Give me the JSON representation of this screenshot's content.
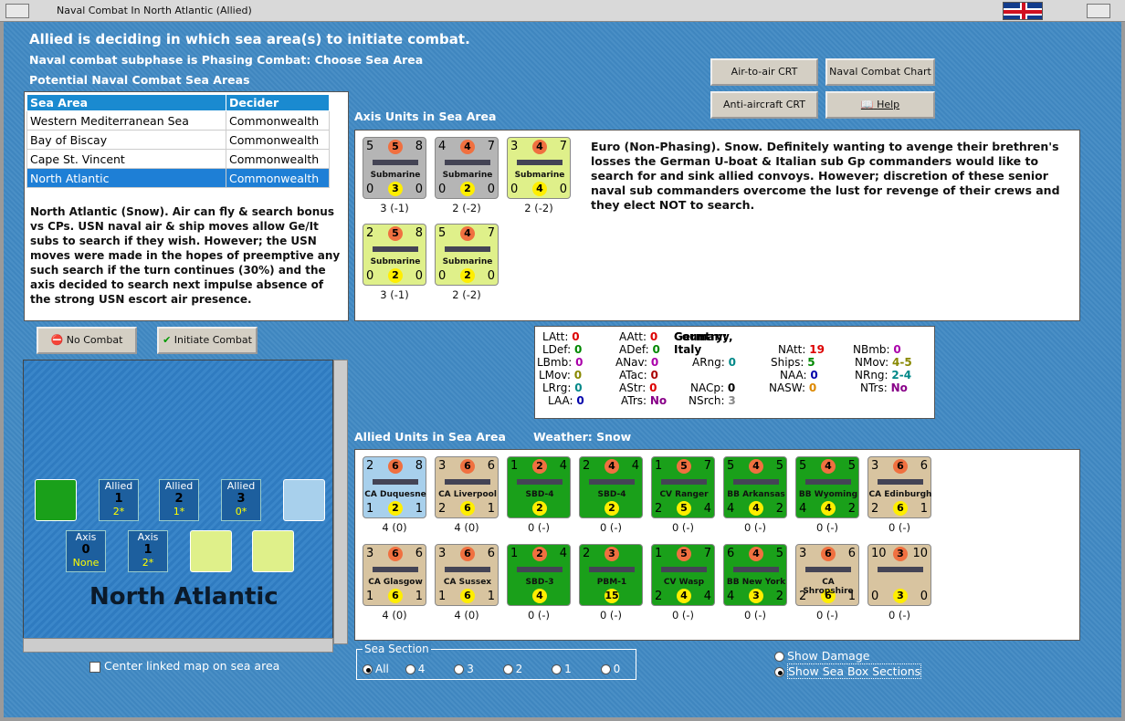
{
  "window": {
    "title": "Naval Combat In North Atlantic (Allied)"
  },
  "header": {
    "line1": "Allied is deciding in which sea area(s) to initiate combat.",
    "line2": "Naval combat subphase is Phasing Combat: Choose Sea Area",
    "line3": "Potential Naval Combat Sea Areas"
  },
  "sea_table": {
    "col1": "Sea Area",
    "col2": "Decider",
    "rows": [
      {
        "area": "Western Mediterranean Sea",
        "decider": "Commonwealth"
      },
      {
        "area": "Bay of Biscay",
        "decider": "Commonwealth"
      },
      {
        "area": "Cape St. Vincent",
        "decider": "Commonwealth"
      },
      {
        "area": "North Atlantic",
        "decider": "Commonwealth"
      }
    ]
  },
  "description": "North Atlantic (Snow).  Air can fly & search bonus vs CPs.  USN naval air & ship moves allow Ge/It subs to search if they wish.  However; the USN moves were made in the hopes of preemptive any such search if the turn continues (30%) and the axis decided to search next impulse absence of the strong USN escort air presence.",
  "buttons": {
    "air": "Air-to-air CRT",
    "naval": "Naval Combat Chart",
    "aa": "Anti-aircraft CRT",
    "help": "Help",
    "no_combat": "No Combat",
    "initiate": "Initiate Combat"
  },
  "axis": {
    "label": "Axis Units in Sea Area",
    "narrative": "Euro (Non-Phasing).  Snow.  Definitely wanting to avenge their brethren's losses the German U-boat & Italian sub Gp commanders would like to search for and sink allied convoys.  However; discretion of these senior naval sub commanders overcome the lust for revenge of their crews and they elect NOT to search.",
    "units": [
      {
        "tl": "5",
        "tc": "5",
        "tr": "8",
        "bl": "0",
        "bc": "3",
        "br": "0",
        "name": "Submarine",
        "cap": "3 (-1)",
        "bg": "#b5b5b5"
      },
      {
        "tl": "4",
        "tc": "4",
        "tr": "7",
        "bl": "0",
        "bc": "2",
        "br": "0",
        "name": "Submarine",
        "cap": "2 (-2)",
        "bg": "#b5b5b5"
      },
      {
        "tl": "3",
        "tc": "4",
        "tr": "7",
        "bl": "0",
        "bc": "4",
        "br": "0",
        "name": "Submarine",
        "cap": "2 (-2)",
        "bg": "#dff08a"
      },
      {
        "tl": "2",
        "tc": "5",
        "tr": "8",
        "bl": "0",
        "bc": "2",
        "br": "0",
        "name": "Submarine",
        "cap": "3 (-1)",
        "bg": "#dff08a"
      },
      {
        "tl": "5",
        "tc": "4",
        "tr": "7",
        "bl": "0",
        "bc": "2",
        "br": "0",
        "name": "Submarine",
        "cap": "2 (-2)",
        "bg": "#dff08a"
      }
    ]
  },
  "stats": {
    "country_label": "Country:",
    "country": "Germany, Italy",
    "LAtt": "0",
    "LDef": "0",
    "LBmb": "0",
    "LMov": "0",
    "LRrg": "0",
    "LAA": "0",
    "AAtt": "0",
    "ADef": "0",
    "ANav": "0",
    "ATac": "0",
    "AStr": "0",
    "ATrs": "No",
    "ARng": "0",
    "NACp": "0",
    "NSrch": "3",
    "NAtt": "19",
    "Ships": "5",
    "NAA": "0",
    "NASW": "0",
    "NBmb": "0",
    "NMov": "4-5",
    "NRng": "2-4",
    "NTrs": "No"
  },
  "allied": {
    "label": "Allied Units in Sea Area",
    "weather": "Weather:  Snow",
    "units": [
      {
        "tl": "2",
        "tc": "6",
        "tr": "8",
        "bl": "1",
        "bc": "2",
        "br": "1",
        "name": "CA Duquesne",
        "cap": "4 (0)",
        "bg": "#a8d0ec"
      },
      {
        "tl": "3",
        "tc": "6",
        "tr": "6",
        "bl": "2",
        "bc": "6",
        "br": "1",
        "name": "CA Liverpool",
        "cap": "4 (0)",
        "bg": "#d8c4a0"
      },
      {
        "tl": "1",
        "tc": "2",
        "tr": "4",
        "bl": "",
        "bc": "2",
        "br": "",
        "name": "SBD-4",
        "cap": "0 (-)",
        "bg": "#1aa01a"
      },
      {
        "tl": "2",
        "tc": "4",
        "tr": "4",
        "bl": "",
        "bc": "2",
        "br": "",
        "name": "SBD-4",
        "cap": "0 (-)",
        "bg": "#1aa01a"
      },
      {
        "tl": "1",
        "tc": "5",
        "tr": "7",
        "bl": "2",
        "bc": "5",
        "br": "4",
        "name": "CV Ranger",
        "cap": "0 (-)",
        "bg": "#1aa01a"
      },
      {
        "tl": "5",
        "tc": "4",
        "tr": "5",
        "bl": "4",
        "bc": "4",
        "br": "2",
        "name": "BB Arkansas",
        "cap": "0 (-)",
        "bg": "#1aa01a"
      },
      {
        "tl": "5",
        "tc": "4",
        "tr": "5",
        "bl": "4",
        "bc": "4",
        "br": "2",
        "name": "BB Wyoming",
        "cap": "0 (-)",
        "bg": "#1aa01a"
      },
      {
        "tl": "3",
        "tc": "6",
        "tr": "6",
        "bl": "2",
        "bc": "6",
        "br": "1",
        "name": "CA Edinburgh",
        "cap": "0 (-)",
        "bg": "#d8c4a0"
      },
      {
        "tl": "3",
        "tc": "6",
        "tr": "6",
        "bl": "1",
        "bc": "6",
        "br": "1",
        "name": "CA Glasgow",
        "cap": "4 (0)",
        "bg": "#d8c4a0"
      },
      {
        "tl": "3",
        "tc": "6",
        "tr": "6",
        "bl": "1",
        "bc": "6",
        "br": "1",
        "name": "CA Sussex",
        "cap": "4 (0)",
        "bg": "#d8c4a0"
      },
      {
        "tl": "1",
        "tc": "2",
        "tr": "4",
        "bl": "",
        "bc": "4",
        "br": "",
        "name": "SBD-3",
        "cap": "0 (-)",
        "bg": "#1aa01a"
      },
      {
        "tl": "2",
        "tc": "3",
        "tr": "",
        "bl": "",
        "bc": "15",
        "br": "",
        "name": "PBM-1",
        "cap": "0 (-)",
        "bg": "#1aa01a"
      },
      {
        "tl": "1",
        "tc": "5",
        "tr": "7",
        "bl": "2",
        "bc": "4",
        "br": "4",
        "name": "CV Wasp",
        "cap": "0 (-)",
        "bg": "#1aa01a"
      },
      {
        "tl": "6",
        "tc": "4",
        "tr": "5",
        "bl": "4",
        "bc": "3",
        "br": "2",
        "name": "BB New York",
        "cap": "0 (-)",
        "bg": "#1aa01a"
      },
      {
        "tl": "3",
        "tc": "6",
        "tr": "6",
        "bl": "2",
        "bc": "6",
        "br": "1",
        "name": "CA Shropshire",
        "cap": "0 (-)",
        "bg": "#d8c4a0"
      },
      {
        "tl": "10",
        "tc": "3",
        "tr": "10",
        "bl": "0",
        "bc": "3",
        "br": "0",
        "name": "",
        "cap": "0 (-)",
        "bg": "#d8c4a0"
      }
    ]
  },
  "map": {
    "title": "North Atlantic",
    "allied_boxes": [
      {
        "n": "1",
        "v": "2*"
      },
      {
        "n": "2",
        "v": "1*"
      },
      {
        "n": "3",
        "v": "0*"
      }
    ],
    "axis_boxes": [
      {
        "n": "0",
        "v": "None"
      },
      {
        "n": "1",
        "v": "2*"
      }
    ],
    "allied_label": "Allied",
    "axis_label": "Axis",
    "center_label": "Center linked map on sea area"
  },
  "sea_section": {
    "label": "Sea Section",
    "options": [
      "All",
      "4",
      "3",
      "2",
      "1",
      "0"
    ]
  },
  "options": {
    "damage": "Show Damage",
    "boxes": "Show Sea Box Sections"
  }
}
